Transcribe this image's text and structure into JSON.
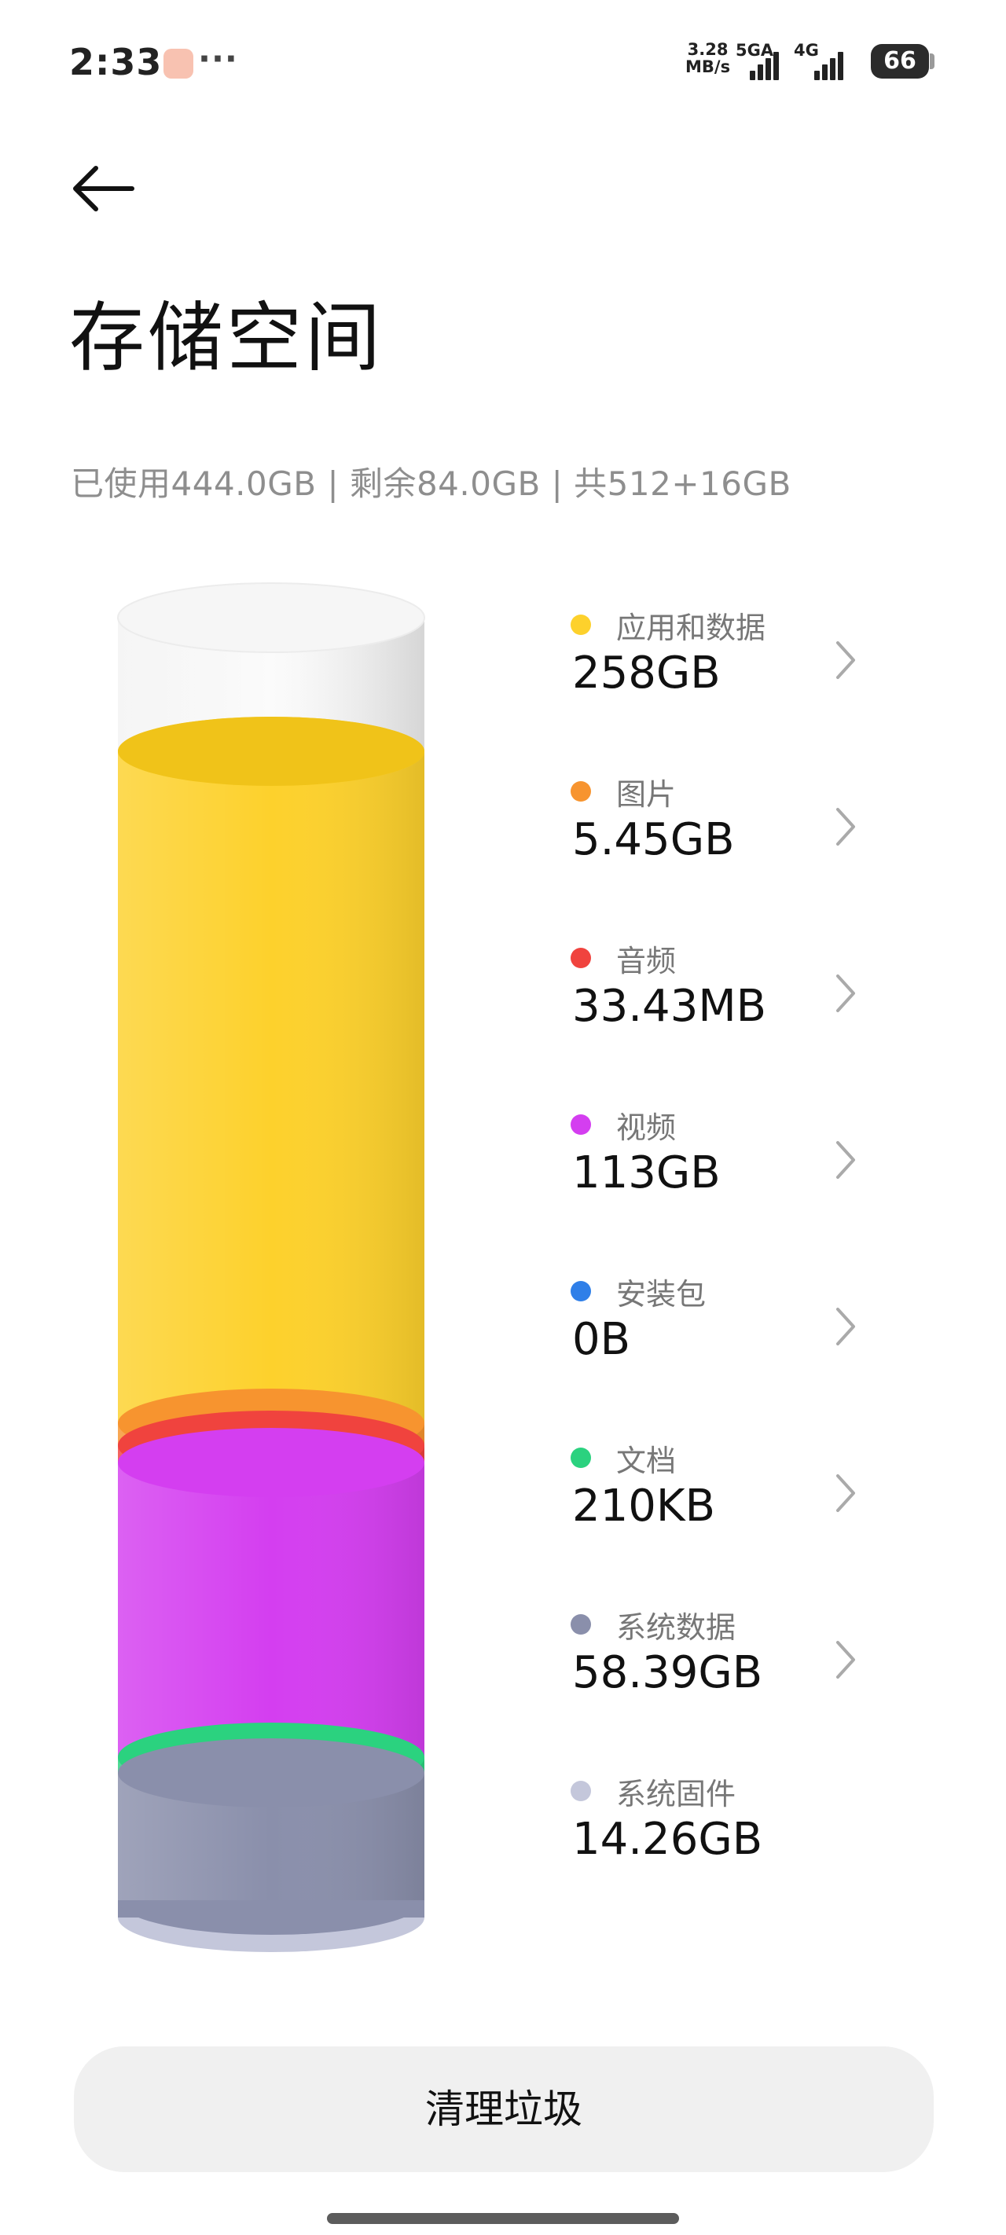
{
  "status_bar": {
    "time": "2:33",
    "more": "···",
    "speed_value": "3.28",
    "speed_unit": "MB/s",
    "network1": "5GA",
    "network2": "4G",
    "battery": "66"
  },
  "page": {
    "title": "存储空间",
    "summary": "已使用444.0GB | 剩余84.0GB | 共512+16GB"
  },
  "usage": {
    "used_gb": 444.0,
    "free_gb": 84.0,
    "total_gb": 528
  },
  "categories": [
    {
      "label": "应用和数据",
      "value": "258GB",
      "color": "#fdd12c"
    },
    {
      "label": "图片",
      "value": "5.45GB",
      "color": "#f7942f"
    },
    {
      "label": "音频",
      "value": "33.43MB",
      "color": "#f0433e"
    },
    {
      "label": "视频",
      "value": "113GB",
      "color": "#d43ef0"
    },
    {
      "label": "安装包",
      "value": "0B",
      "color": "#2f7fe8"
    },
    {
      "label": "文档",
      "value": "210KB",
      "color": "#2bd27f"
    },
    {
      "label": "系统数据",
      "value": "58.39GB",
      "color": "#8a8fab"
    },
    {
      "label": "系统固件",
      "value": "14.26GB",
      "color": "#c4c7db"
    }
  ],
  "actions": {
    "clean_label": "清理垃圾"
  }
}
